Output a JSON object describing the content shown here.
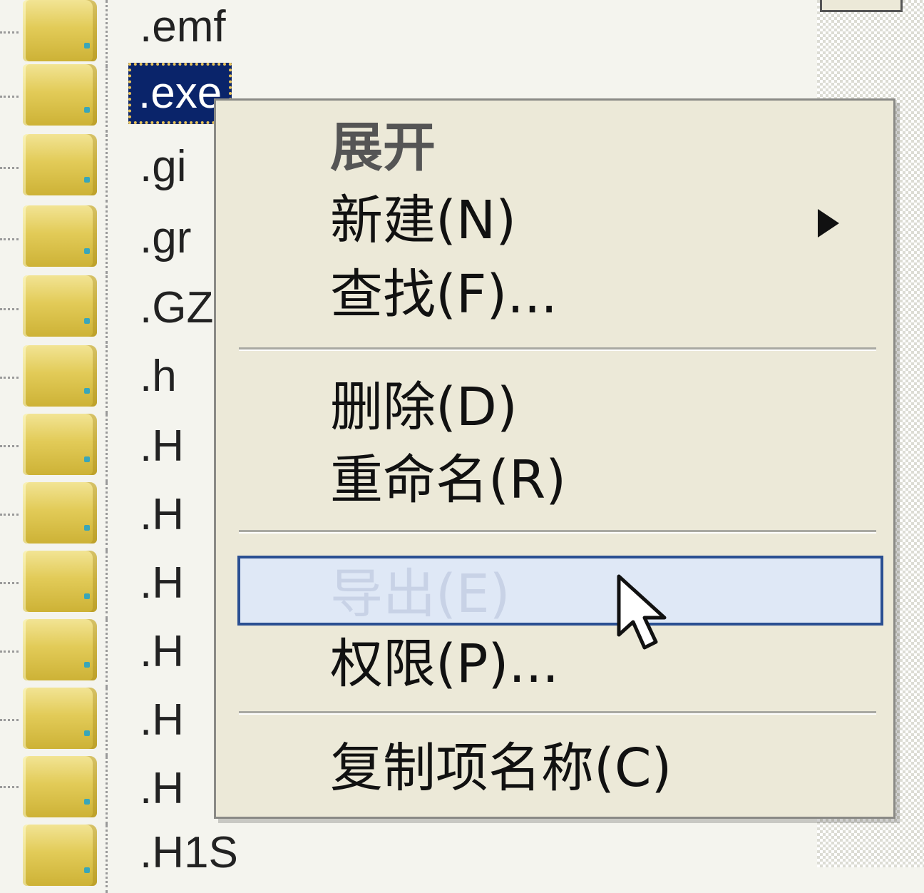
{
  "tree": {
    "items": [
      {
        "label": ".emf",
        "selected": false
      },
      {
        "label": ".exe",
        "selected": true
      },
      {
        "label": ".gi",
        "selected": false
      },
      {
        "label": ".gr",
        "selected": false
      },
      {
        "label": ".GZ",
        "selected": false
      },
      {
        "label": ".h",
        "selected": false
      },
      {
        "label": ".H",
        "selected": false
      },
      {
        "label": ".H",
        "selected": false
      },
      {
        "label": ".H",
        "selected": false
      },
      {
        "label": ".H",
        "selected": false
      },
      {
        "label": ".H",
        "selected": false
      },
      {
        "label": ".H",
        "selected": false
      },
      {
        "label": ".H1S",
        "selected": false
      }
    ],
    "folder_icon": "folder-icon"
  },
  "context_menu": {
    "items": [
      {
        "label": "展开",
        "bold": true,
        "submenu": false
      },
      {
        "label": "新建(N)",
        "bold": false,
        "submenu": true
      },
      {
        "label": "查找(F)...",
        "bold": false,
        "submenu": false
      },
      {
        "separator": true
      },
      {
        "label": "删除(D)",
        "bold": false,
        "submenu": false
      },
      {
        "label": "重命名(R)",
        "bold": false,
        "submenu": false
      },
      {
        "separator": true
      },
      {
        "label": "导出(E)",
        "bold": false,
        "submenu": false,
        "hovered": true
      },
      {
        "label": "权限(P)...",
        "bold": false,
        "submenu": false
      },
      {
        "separator": true
      },
      {
        "label": "复制项名称(C)",
        "bold": false,
        "submenu": false
      }
    ],
    "highlight_color": "#dfe8f6",
    "highlight_border": "#2a4f92",
    "submenu_icon": "submenu-arrow-icon"
  },
  "colors": {
    "selection": "#0a246a",
    "menu_background": "#ece9d8",
    "folder": "#e2cb58"
  },
  "cursor_icon": "mouse-pointer-icon"
}
